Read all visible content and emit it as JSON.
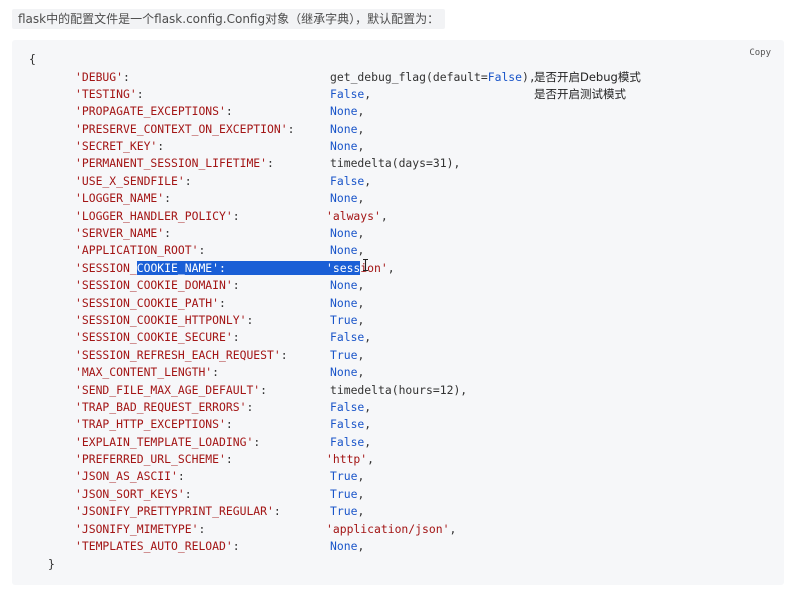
{
  "intro": {
    "code": "flask",
    "text_a": "中的配置文件是一个",
    "code_b": "flask.config.Config",
    "text_b": "对象（继承字典），默认配置为："
  },
  "code_block": {
    "copy_label": "Copy",
    "open_brace": "{",
    "close_brace": "}",
    "lines": [
      {
        "key": "'DEBUG'",
        "value": "get_debug_flag(default=False),",
        "comment": "是否开启Debug模式"
      },
      {
        "key": "'TESTING'",
        "value": "False,",
        "comment": "是否开启测试模式"
      },
      {
        "key": "'PROPAGATE_EXCEPTIONS'",
        "value": "None,"
      },
      {
        "key": "'PRESERVE_CONTEXT_ON_EXCEPTION'",
        "value": "None,"
      },
      {
        "key": "'SECRET_KEY'",
        "value": "None,"
      },
      {
        "key": "'PERMANENT_SESSION_LIFETIME'",
        "value": "timedelta(days=31),"
      },
      {
        "key": "'USE_X_SENDFILE'",
        "value": "False,"
      },
      {
        "key": "'LOGGER_NAME'",
        "value": "None,"
      },
      {
        "key": "'LOGGER_HANDLER_POLICY'",
        "value": "'always',"
      },
      {
        "key": "'SERVER_NAME'",
        "value": "None,"
      },
      {
        "key": "'APPLICATION_ROOT'",
        "value": "None,"
      },
      {
        "key": "'SESSION_COOKIE_NAME'",
        "value": "'session',"
      },
      {
        "key": "'SESSION_COOKIE_DOMAIN'",
        "value": "None,"
      },
      {
        "key": "'SESSION_COOKIE_PATH'",
        "value": "None,"
      },
      {
        "key": "'SESSION_COOKIE_HTTPONLY'",
        "value": "True,"
      },
      {
        "key": "'SESSION_COOKIE_SECURE'",
        "value": "False,"
      },
      {
        "key": "'SESSION_REFRESH_EACH_REQUEST'",
        "value": "True,"
      },
      {
        "key": "'MAX_CONTENT_LENGTH'",
        "value": "None,"
      },
      {
        "key": "'SEND_FILE_MAX_AGE_DEFAULT'",
        "value": "timedelta(hours=12),"
      },
      {
        "key": "'TRAP_BAD_REQUEST_ERRORS'",
        "value": "False,"
      },
      {
        "key": "'TRAP_HTTP_EXCEPTIONS'",
        "value": "False,"
      },
      {
        "key": "'EXPLAIN_TEMPLATE_LOADING'",
        "value": "False,"
      },
      {
        "key": "'PREFERRED_URL_SCHEME'",
        "value": "'http',"
      },
      {
        "key": "'JSON_AS_ASCII'",
        "value": "True,"
      },
      {
        "key": "'JSON_SORT_KEYS'",
        "value": "True,"
      },
      {
        "key": "'JSONIFY_PRETTYPRINT_REGULAR'",
        "value": "True,"
      },
      {
        "key": "'JSONIFY_MIMETYPE'",
        "value": "'application/json',"
      },
      {
        "key": "'TEMPLATES_AUTO_RELOAD'",
        "value": "None,"
      }
    ]
  },
  "colors": {
    "key": "#a31515",
    "literal": "#1a55c9",
    "selection": "#1a5fd6",
    "block_bg": "#f6f7f9"
  },
  "icons": {
    "cursor": "text-cursor-icon"
  }
}
